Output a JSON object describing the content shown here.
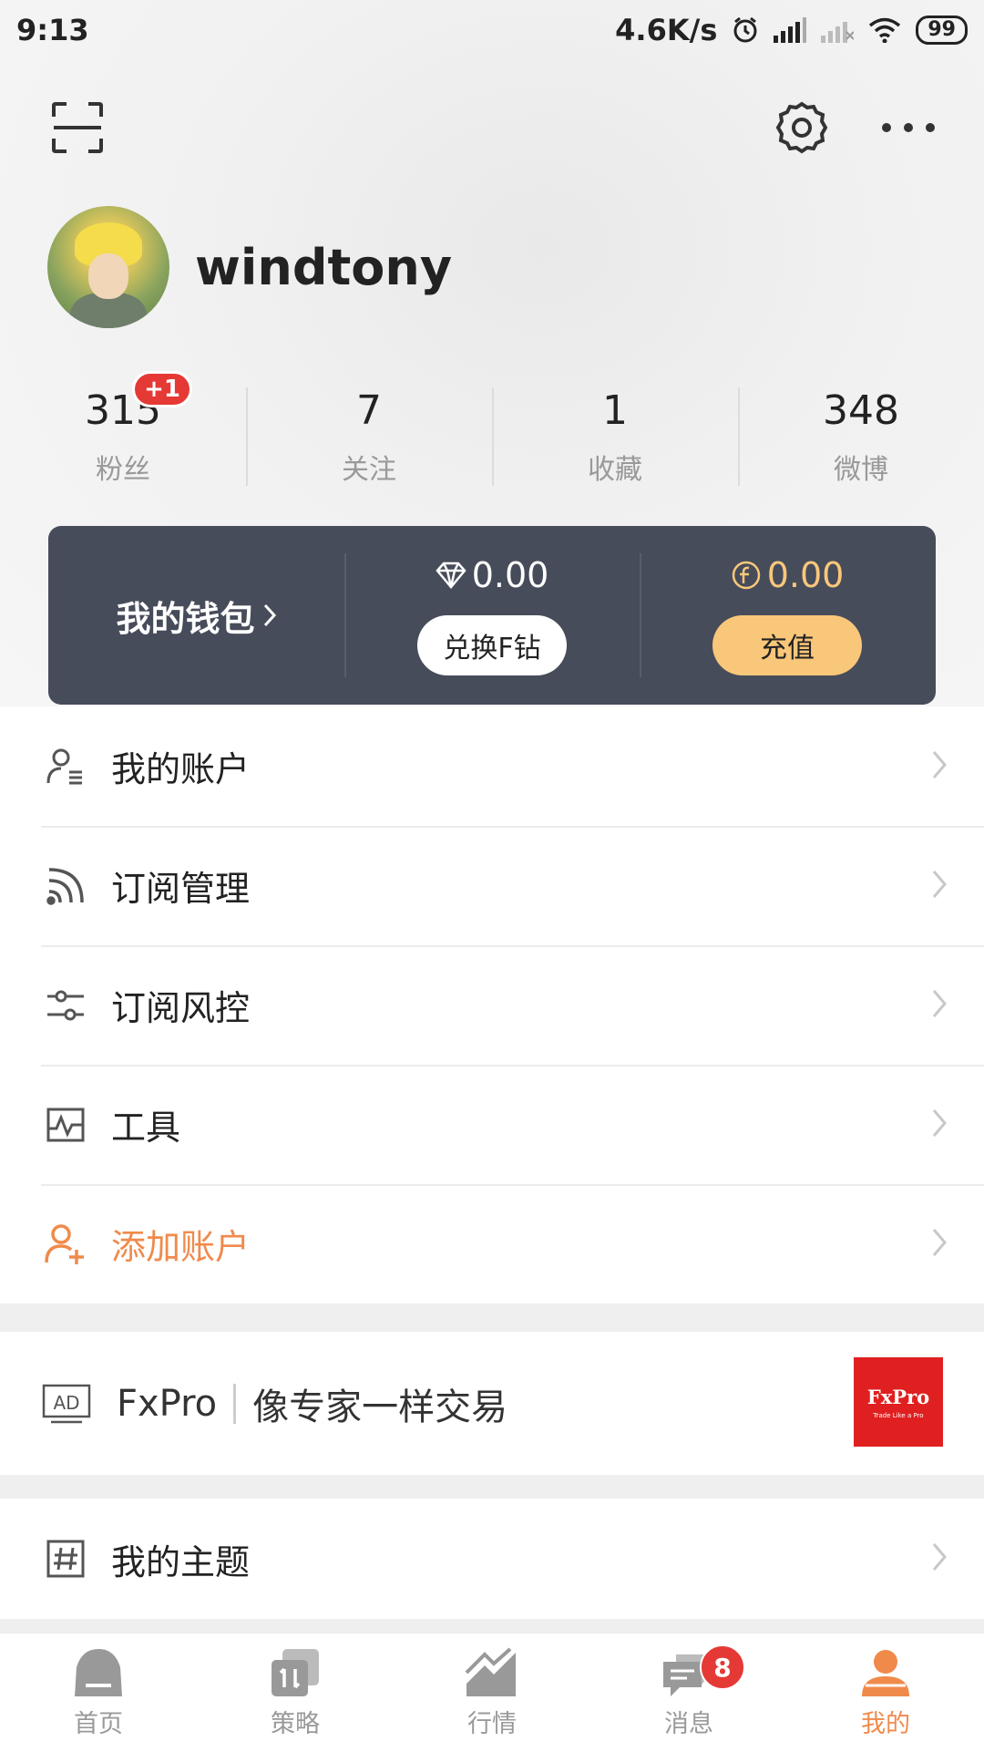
{
  "status_bar": {
    "time": "9:13",
    "net_speed": "4.6K/s",
    "battery": "99"
  },
  "profile": {
    "username": "windtony"
  },
  "stats": [
    {
      "value": "315",
      "label": "粉丝",
      "badge": "+1"
    },
    {
      "value": "7",
      "label": "关注"
    },
    {
      "value": "1",
      "label": "收藏"
    },
    {
      "value": "348",
      "label": "微博"
    }
  ],
  "wallet": {
    "title": "我的钱包",
    "diamond_amount": "0.00",
    "exchange_label": "兑换F钻",
    "coin_amount": "0.00",
    "recharge_label": "充值"
  },
  "menu": [
    {
      "label": "我的账户",
      "icon": "account-icon"
    },
    {
      "label": "订阅管理",
      "icon": "rss-icon"
    },
    {
      "label": "订阅风控",
      "icon": "sliders-icon"
    },
    {
      "label": "工具",
      "icon": "pulse-chart-icon"
    },
    {
      "label": "添加账户",
      "icon": "add-user-icon",
      "accent": "#f08a4b"
    }
  ],
  "ad": {
    "tag": "AD",
    "brand": "FxPro",
    "slogan": "像专家一样交易",
    "logo_text": "FxPro",
    "logo_sub": "Trade Like a Pro"
  },
  "topic": {
    "label": "我的主题"
  },
  "tabs": [
    {
      "label": "首页",
      "icon": "home-icon"
    },
    {
      "label": "策略",
      "icon": "strategy-icon"
    },
    {
      "label": "行情",
      "icon": "market-icon"
    },
    {
      "label": "消息",
      "icon": "message-icon",
      "badge": "8"
    },
    {
      "label": "我的",
      "icon": "profile-icon",
      "active": true
    }
  ],
  "colors": {
    "accent": "#f08a4b",
    "wallet_bg": "#474c5a",
    "gold": "#f9c77a",
    "badge": "#e53935"
  }
}
